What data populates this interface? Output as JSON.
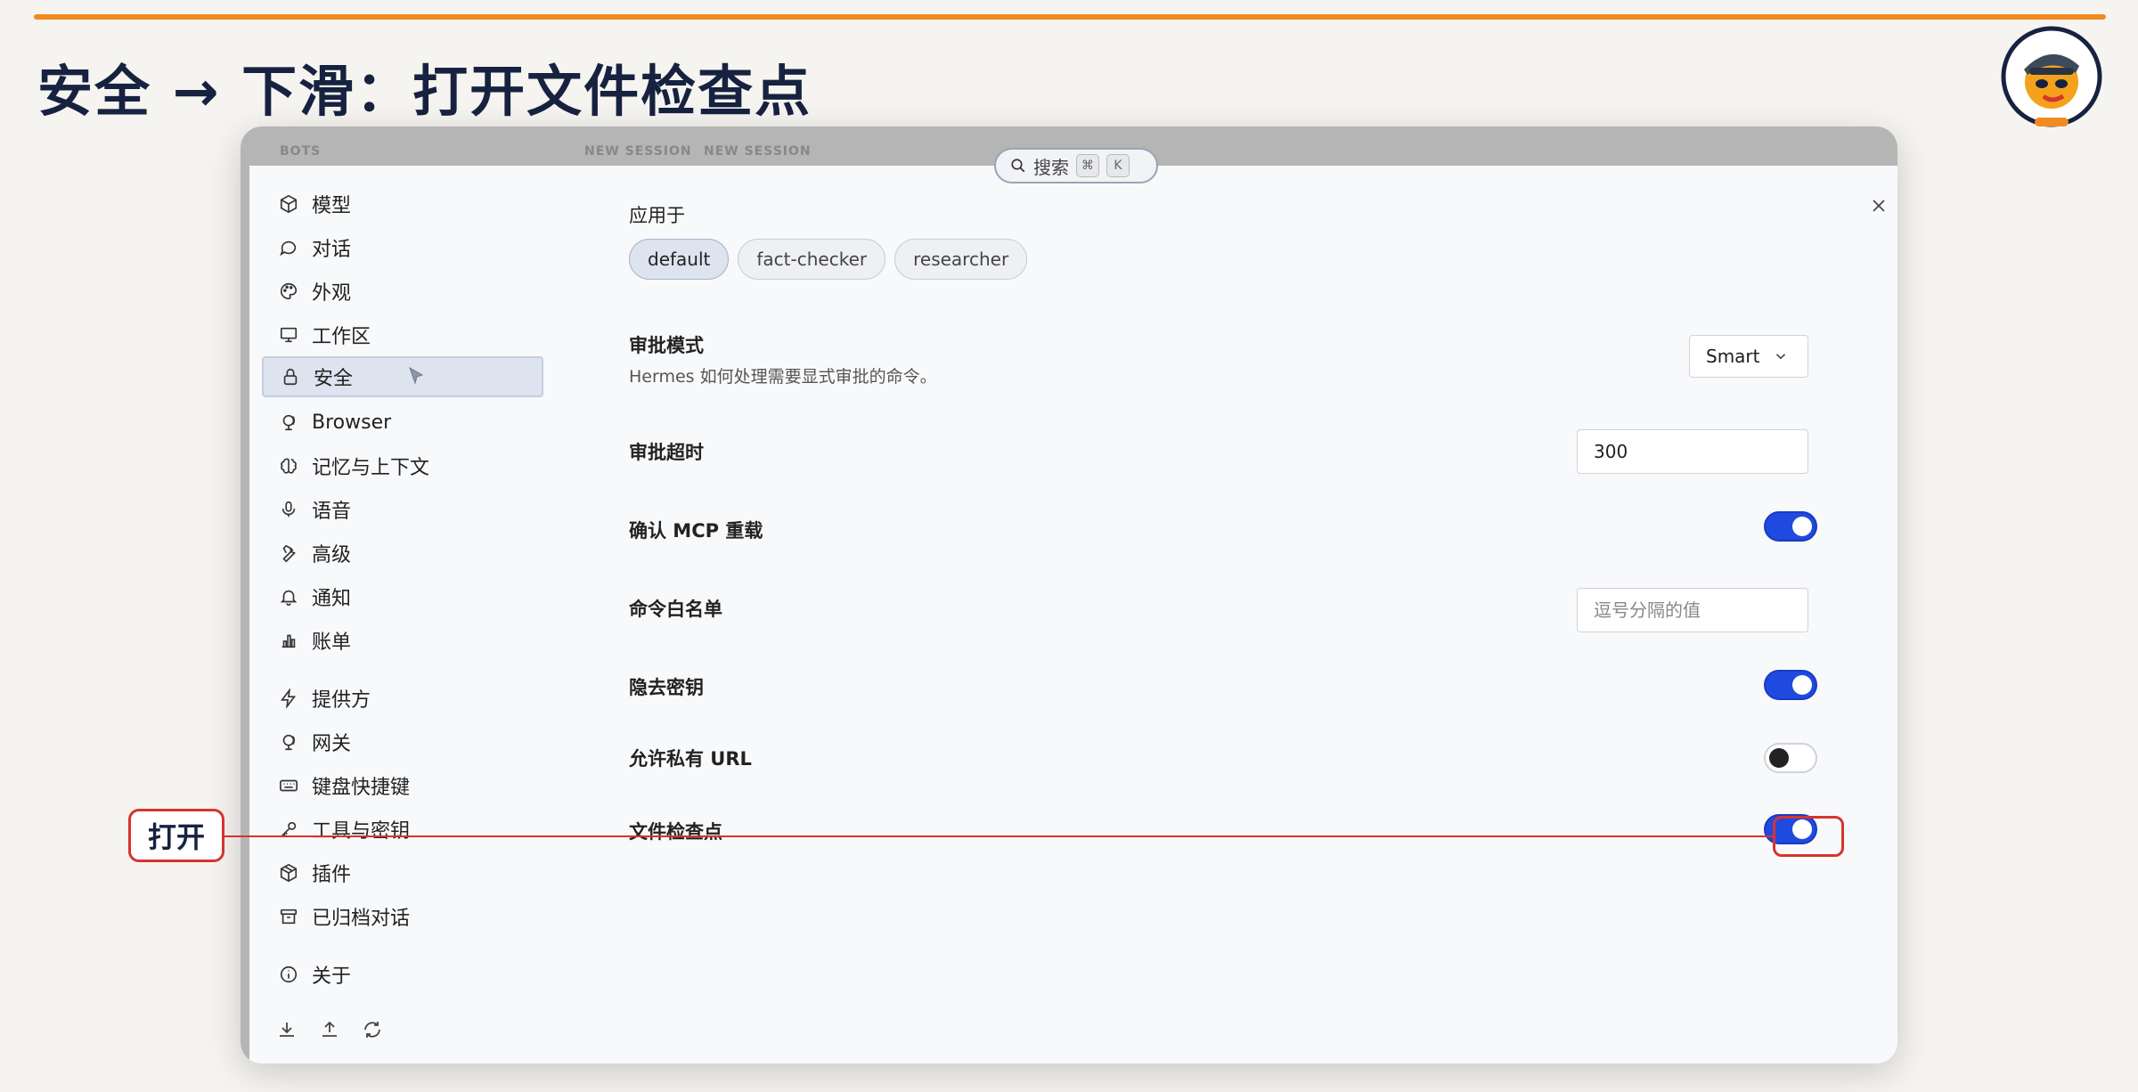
{
  "slide": {
    "title": "安全 → 下滑：打开文件检查点",
    "accent_color": "#f28a22",
    "title_color": "#162240"
  },
  "backdrop": {
    "tabs": [
      "BOTS",
      "NEW SESSION",
      "NEW SESSION"
    ]
  },
  "search": {
    "label": "搜索",
    "shortcut_keys": [
      "⌘",
      "K"
    ]
  },
  "sidebar": {
    "items": [
      {
        "label": "模型",
        "icon": "cube-icon"
      },
      {
        "label": "对话",
        "icon": "chat-bubble-icon"
      },
      {
        "label": "外观",
        "icon": "palette-icon"
      },
      {
        "label": "工作区",
        "icon": "monitor-icon"
      },
      {
        "label": "安全",
        "icon": "lock-icon",
        "active": true
      },
      {
        "label": "Browser",
        "icon": "globe-icon"
      },
      {
        "label": "记忆与上下文",
        "icon": "brain-icon"
      },
      {
        "label": "语音",
        "icon": "microphone-icon"
      },
      {
        "label": "高级",
        "icon": "wrench-icon"
      },
      {
        "label": "通知",
        "icon": "bell-icon"
      },
      {
        "label": "账单",
        "icon": "bar-chart-icon"
      },
      {
        "label": "提供方",
        "icon": "bolt-icon"
      },
      {
        "label": "网关",
        "icon": "globe-stand-icon"
      },
      {
        "label": "键盘快捷键",
        "icon": "keyboard-icon"
      },
      {
        "label": "工具与密钥",
        "icon": "key-icon"
      },
      {
        "label": "插件",
        "icon": "package-icon"
      },
      {
        "label": "已归档对话",
        "icon": "archive-icon"
      },
      {
        "label": "关于",
        "icon": "info-icon"
      }
    ],
    "bottom_icons": [
      "download-icon",
      "upload-icon",
      "refresh-icon"
    ]
  },
  "settings": {
    "apply_to": {
      "label": "应用于",
      "chips": [
        "default",
        "fact-checker",
        "researcher"
      ],
      "selected": "default"
    },
    "approval_mode": {
      "label": "审批模式",
      "description": "Hermes 如何处理需要显式审批的命令。",
      "value": "Smart"
    },
    "approval_timeout": {
      "label": "审批超时",
      "value": "300"
    },
    "confirm_mcp_reload": {
      "label": "确认 MCP 重载",
      "enabled": true
    },
    "command_allowlist": {
      "label": "命令白名单",
      "placeholder": "逗号分隔的值"
    },
    "hide_secrets": {
      "label": "隐去密钥",
      "enabled": true
    },
    "allow_private_urls": {
      "label": "允许私有 URL",
      "enabled": false
    },
    "file_checkpoints": {
      "label": "文件检查点",
      "enabled": true
    }
  },
  "annotation": {
    "label": "打开",
    "color": "#d6342f"
  },
  "toggle_on_color": "#1f4ae0"
}
